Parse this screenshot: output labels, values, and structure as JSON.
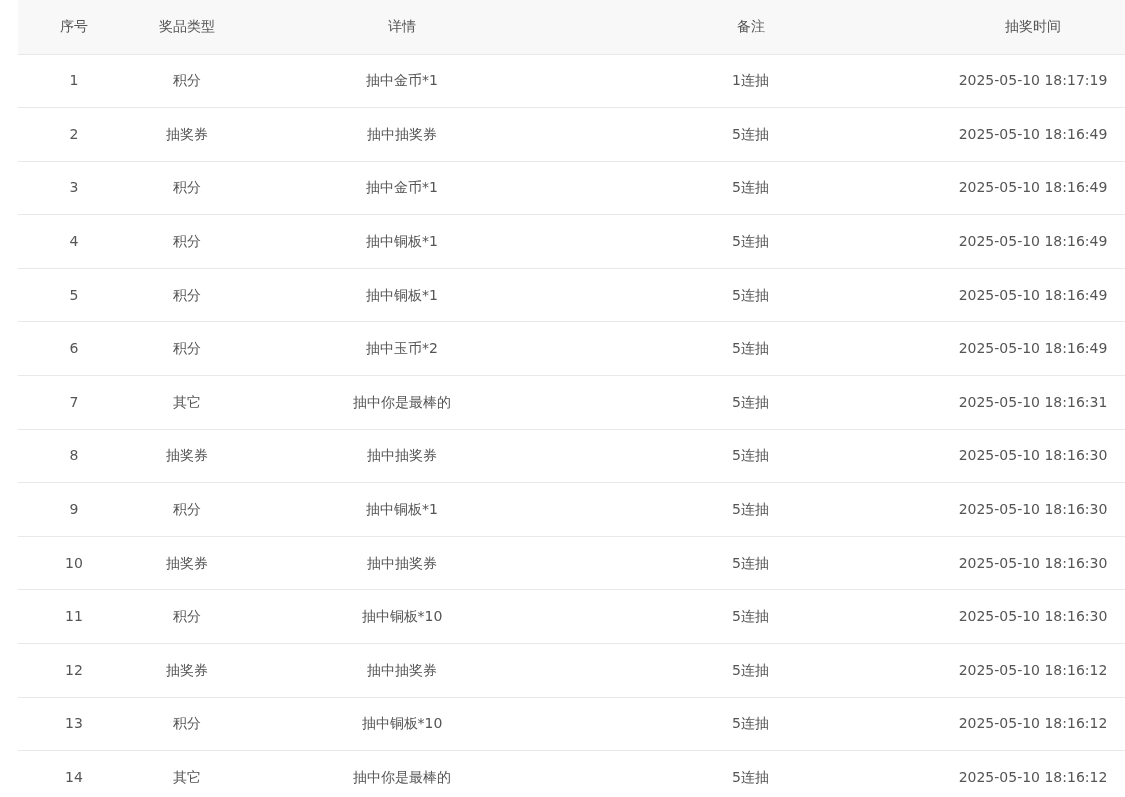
{
  "table": {
    "columns": [
      "序号",
      "奖品类型",
      "详情",
      "备注",
      "抽奖时间"
    ],
    "rows": [
      [
        "1",
        "积分",
        "抽中金币*1",
        "1连抽",
        "2025-05-10 18:17:19"
      ],
      [
        "2",
        "抽奖券",
        "抽中抽奖券",
        "5连抽",
        "2025-05-10 18:16:49"
      ],
      [
        "3",
        "积分",
        "抽中金币*1",
        "5连抽",
        "2025-05-10 18:16:49"
      ],
      [
        "4",
        "积分",
        "抽中铜板*1",
        "5连抽",
        "2025-05-10 18:16:49"
      ],
      [
        "5",
        "积分",
        "抽中铜板*1",
        "5连抽",
        "2025-05-10 18:16:49"
      ],
      [
        "6",
        "积分",
        "抽中玉币*2",
        "5连抽",
        "2025-05-10 18:16:49"
      ],
      [
        "7",
        "其它",
        "抽中你是最棒的",
        "5连抽",
        "2025-05-10 18:16:31"
      ],
      [
        "8",
        "抽奖券",
        "抽中抽奖券",
        "5连抽",
        "2025-05-10 18:16:30"
      ],
      [
        "9",
        "积分",
        "抽中铜板*1",
        "5连抽",
        "2025-05-10 18:16:30"
      ],
      [
        "10",
        "抽奖券",
        "抽中抽奖券",
        "5连抽",
        "2025-05-10 18:16:30"
      ],
      [
        "11",
        "积分",
        "抽中铜板*10",
        "5连抽",
        "2025-05-10 18:16:30"
      ],
      [
        "12",
        "抽奖券",
        "抽中抽奖券",
        "5连抽",
        "2025-05-10 18:16:12"
      ],
      [
        "13",
        "积分",
        "抽中铜板*10",
        "5连抽",
        "2025-05-10 18:16:12"
      ],
      [
        "14",
        "其它",
        "抽中你是最棒的",
        "5连抽",
        "2025-05-10 18:16:12"
      ]
    ]
  }
}
